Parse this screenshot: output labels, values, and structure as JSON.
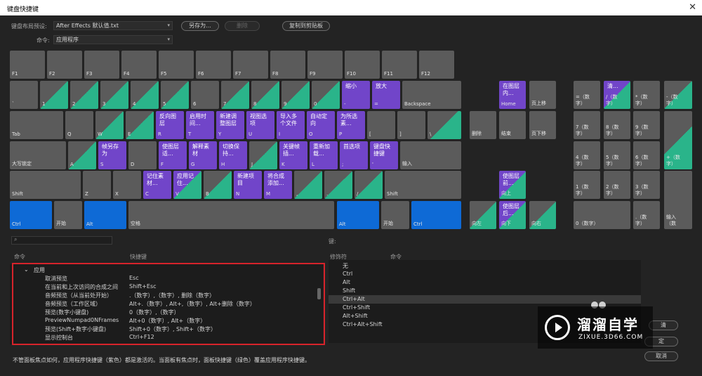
{
  "window": {
    "title": "键盘快捷键",
    "close_glyph": "✕"
  },
  "preset": {
    "label": "键盘布局预设:",
    "value": "After Effects 默认值.txt"
  },
  "command": {
    "label": "命令:",
    "value": "应用程序"
  },
  "buttons": {
    "save_as": "另存为...",
    "delete": "删除",
    "copy_clipboard": "复制到剪贴板",
    "cancel": "取消",
    "ok_partial": "定",
    "clear_partial": "清"
  },
  "keyboard": {
    "function_row": [
      "",
      "F1",
      "F2",
      "F3",
      "F4",
      "F5",
      "F6",
      "F7",
      "F8",
      "F9",
      "F10",
      "F11",
      "F12"
    ],
    "number_row": [
      {
        "label": "`",
        "cmd": ""
      },
      {
        "label": "1",
        "cmd": ""
      },
      {
        "label": "2",
        "cmd": ""
      },
      {
        "label": "3",
        "cmd": ""
      },
      {
        "label": "4",
        "cmd": ""
      },
      {
        "label": "5",
        "cmd": ""
      },
      {
        "label": "6",
        "cmd": ""
      },
      {
        "label": "7",
        "cmd": ""
      },
      {
        "label": "8",
        "cmd": ""
      },
      {
        "label": "9",
        "cmd": ""
      },
      {
        "label": "0",
        "cmd": ""
      },
      {
        "label": "-",
        "cmd": "缩小"
      },
      {
        "label": "=",
        "cmd": "放大"
      },
      {
        "label": "Backspace",
        "cmd": ""
      }
    ],
    "qwerty_row": [
      {
        "label": "Tab",
        "cmd": ""
      },
      {
        "label": "Q",
        "cmd": ""
      },
      {
        "label": "W",
        "cmd": ""
      },
      {
        "label": "E",
        "cmd": ""
      },
      {
        "label": "R",
        "cmd": "反向图\n层"
      },
      {
        "label": "T",
        "cmd": "启用时\n间..."
      },
      {
        "label": "Y",
        "cmd": "新建调\n整图层"
      },
      {
        "label": "U",
        "cmd": "视图选\n项"
      },
      {
        "label": "I",
        "cmd": "导入多\n个文件"
      },
      {
        "label": "O",
        "cmd": "自动定\n向"
      },
      {
        "label": "P",
        "cmd": "为所选\n素..."
      },
      {
        "label": "[",
        "cmd": ""
      },
      {
        "label": "]",
        "cmd": ""
      },
      {
        "label": "\\",
        "cmd": ""
      }
    ],
    "home_row": [
      {
        "label": "大写锁定",
        "cmd": ""
      },
      {
        "label": "A",
        "cmd": ""
      },
      {
        "label": "S",
        "cmd": "帧另存\n为"
      },
      {
        "label": "D",
        "cmd": ""
      },
      {
        "label": "F",
        "cmd": "使图层\n适..."
      },
      {
        "label": "G",
        "cmd": "解释素\n材"
      },
      {
        "label": "H",
        "cmd": "切换保\n持..."
      },
      {
        "label": "J",
        "cmd": ""
      },
      {
        "label": "K",
        "cmd": "关键帧\n插..."
      },
      {
        "label": "L",
        "cmd": "重新加\n载..."
      },
      {
        "label": ";",
        "cmd": "首选项"
      },
      {
        "label": "'",
        "cmd": "键盘快\n捷键"
      },
      {
        "label": "输入",
        "cmd": ""
      }
    ],
    "shift_row": [
      {
        "label": "Shift",
        "cmd": ""
      },
      {
        "label": "Z",
        "cmd": ""
      },
      {
        "label": "X",
        "cmd": ""
      },
      {
        "label": "C",
        "cmd": "记住素\n材..."
      },
      {
        "label": "V",
        "cmd": "应用记\n住..."
      },
      {
        "label": "B",
        "cmd": ""
      },
      {
        "label": "N",
        "cmd": "新建项\n目"
      },
      {
        "label": "M",
        "cmd": "将合成\n添加..."
      },
      {
        "label": ",",
        "cmd": ""
      },
      {
        "label": ".",
        "cmd": ""
      },
      {
        "label": "/",
        "cmd": ""
      },
      {
        "label": "Shift",
        "cmd": ""
      }
    ],
    "bottom_row": [
      {
        "label": "Ctrl"
      },
      {
        "label": "开始"
      },
      {
        "label": "Alt"
      },
      {
        "label": "空格"
      },
      {
        "label": "Alt"
      },
      {
        "label": "开始"
      },
      {
        "label": "Ctrl"
      }
    ],
    "nav": {
      "home": {
        "label": "Home",
        "cmd": "在图层\n内..."
      },
      "pageup": {
        "label": "页上移",
        "cmd": ""
      },
      "delete": {
        "label": "删除",
        "cmd": ""
      },
      "end": {
        "label": "结束",
        "cmd": ""
      },
      "pagedown": {
        "label": "页下移",
        "cmd": ""
      },
      "up": {
        "label": "向上",
        "cmd": "使图层\n前..."
      },
      "left": {
        "label": "向左",
        "cmd": ""
      },
      "down": {
        "label": "向下",
        "cmd": "使图层\n后..."
      },
      "right": {
        "label": "向右",
        "cmd": ""
      }
    },
    "numpad": {
      "row1": [
        {
          "label": "=（数\n字）",
          "cmd": ""
        },
        {
          "label": "/（数\n字）",
          "cmd": "清..."
        },
        {
          "label": "*（数\n字）",
          "cmd": ""
        },
        {
          "label": "-（数\n字）",
          "cmd": ""
        }
      ],
      "row2": [
        {
          "label": "7（数\n字）",
          "cmd": ""
        },
        {
          "label": "8（数\n字）",
          "cmd": ""
        },
        {
          "label": "9（数\n字）",
          "cmd": ""
        },
        {
          "label": "+（数\n字）",
          "cmd": ""
        }
      ],
      "row3": [
        {
          "label": "4（数\n字）",
          "cmd": ""
        },
        {
          "label": "5（数\n字）",
          "cmd": ""
        },
        {
          "label": "6（数\n字）",
          "cmd": ""
        }
      ],
      "row4": [
        {
          "label": "1（数\n字）",
          "cmd": ""
        },
        {
          "label": "2（数\n字）",
          "cmd": ""
        },
        {
          "label": "3（数\n字）",
          "cmd": ""
        },
        {
          "label": "输入\n（数",
          "cmd": ""
        }
      ],
      "row5": [
        {
          "label": "0（数字）",
          "cmd": ""
        },
        {
          "label": ".（数\n字）",
          "cmd": ""
        }
      ]
    }
  },
  "search": {
    "icon": "search-icon",
    "glyph": "⌕"
  },
  "command_list": {
    "col_command": "命令",
    "col_shortcut": "快捷键",
    "group": "应用",
    "group_glyph": "⌄",
    "rows": [
      {
        "command": "取消预览",
        "shortcut": "Esc"
      },
      {
        "command": "在当前和上次访问的合成之间",
        "shortcut": "Shift+Esc"
      },
      {
        "command": "音频预览（从当前处开始）",
        "shortcut": ".（数字）,（数字）, 删除（数字）"
      },
      {
        "command": "音频预览（工作区域）",
        "shortcut": "Alt+.（数字）, Alt+,（数字）, Alt+删除（数字）"
      },
      {
        "command": "预览(数字小键盘)",
        "shortcut": "0（数字）,（数字）"
      },
      {
        "command": "PreviewNumpad0NFrames",
        "shortcut": "Alt+0（数字）, Alt+（数字）"
      },
      {
        "command": "预览(Shift+数字小键盘)",
        "shortcut": "Shift+0（数字）, Shift+（数字）"
      },
      {
        "command": "显示控制台",
        "shortcut": "Ctrl+F12"
      }
    ]
  },
  "modifier_panel": {
    "key_label": "键:",
    "col_modifier": "修饰符",
    "col_command": "命令",
    "rows": [
      "无",
      "Ctrl",
      "Alt",
      "Shift",
      "Ctrl+Alt",
      "Ctrl+Shift",
      "Alt+Shift",
      "Ctrl+Alt+Shift"
    ],
    "selected_index": 4
  },
  "footer_text": "不管面板焦点如何，应用程序快捷键（紫色）都是激活的。当面板有焦点时，面板快捷键（绿色）覆盖应用程序快捷键。",
  "watermark": {
    "brand": "溜溜自学",
    "url": "ZIXUE.3D66.COM"
  },
  "colors": {
    "app_shortcut": "#7145c9",
    "panel_shortcut": "#2ab48a",
    "modifier_key": "#0e6ad6",
    "key": "#5b5b5b",
    "highlight_box": "#d7232b"
  }
}
